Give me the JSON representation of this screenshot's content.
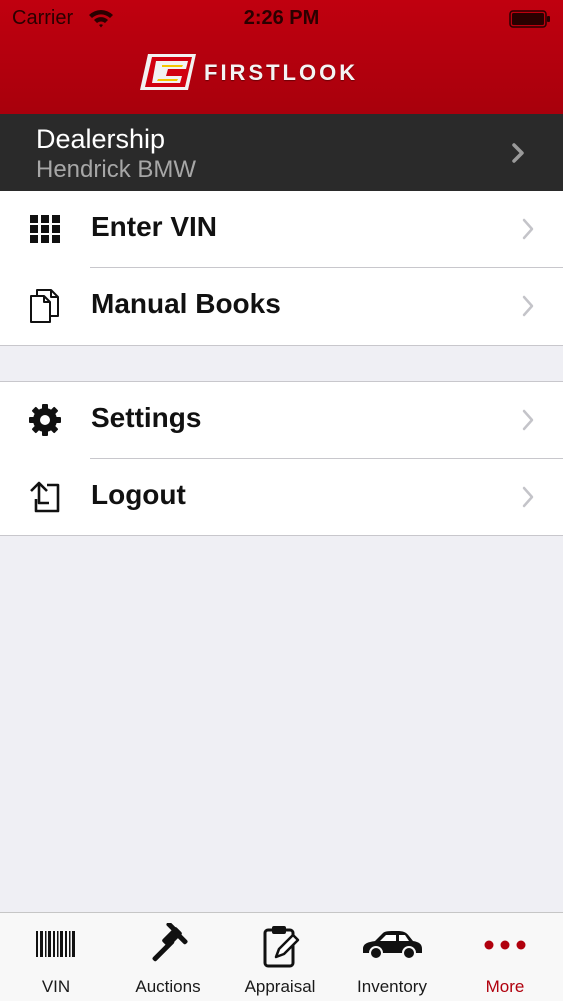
{
  "status_bar": {
    "carrier": "Carrier",
    "time": "2:26 PM"
  },
  "app": {
    "logo_text": "FIRSTLOOK",
    "brand_color": "#b3000e"
  },
  "dealership": {
    "label": "Dealership",
    "value": "Hendrick BMW"
  },
  "menu_groups": [
    {
      "items": [
        {
          "label": "Enter VIN",
          "icon": "keypad-icon"
        },
        {
          "label": "Manual Books",
          "icon": "documents-icon"
        }
      ]
    },
    {
      "items": [
        {
          "label": "Settings",
          "icon": "gear-icon"
        },
        {
          "label": "Logout",
          "icon": "logout-icon"
        }
      ]
    }
  ],
  "tab_bar": {
    "active": "More",
    "tabs": [
      {
        "label": "VIN",
        "icon": "barcode-icon"
      },
      {
        "label": "Auctions",
        "icon": "gavel-icon"
      },
      {
        "label": "Appraisal",
        "icon": "clipboard-icon"
      },
      {
        "label": "Inventory",
        "icon": "car-icon"
      },
      {
        "label": "More",
        "icon": "more-dots-icon"
      }
    ]
  }
}
